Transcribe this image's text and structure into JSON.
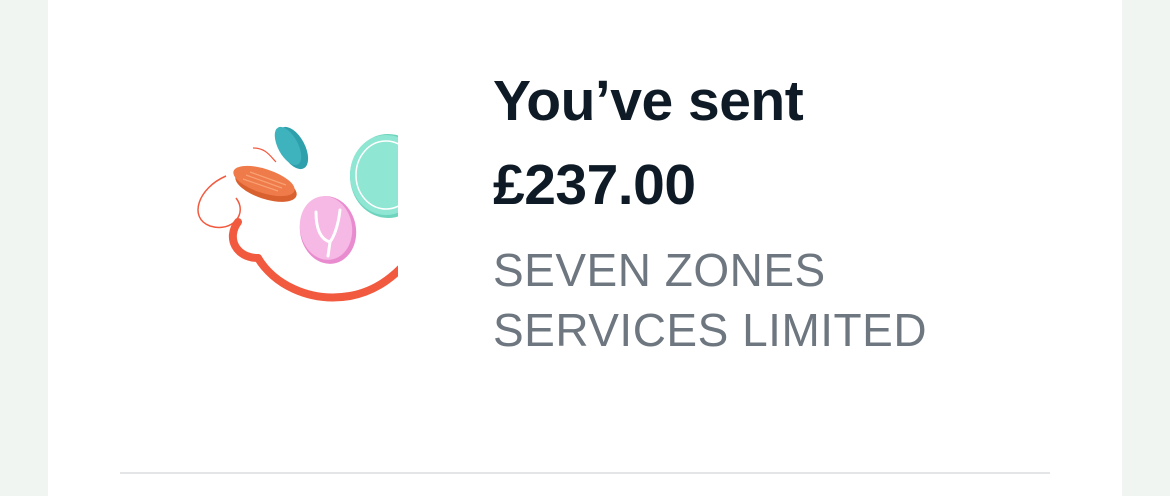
{
  "confirmation": {
    "headline": "You’ve sent",
    "amount": "£237.00",
    "recipient": "SEVEN ZONES SERVICES LIMITED"
  },
  "illustration": {
    "icon": "coins-sent-illustration",
    "colors": {
      "orange_coin": "#ef7a4a",
      "teal_coin": "#2ea0ab",
      "mint_coin": "#8ee6d3",
      "pink_coin": "#f2a8dc",
      "arrow": "#f25a3f"
    }
  },
  "colors": {
    "background": "#f1f5f2",
    "card": "#ffffff",
    "headline_text": "#0e1b26",
    "secondary_text": "#6e7780"
  }
}
